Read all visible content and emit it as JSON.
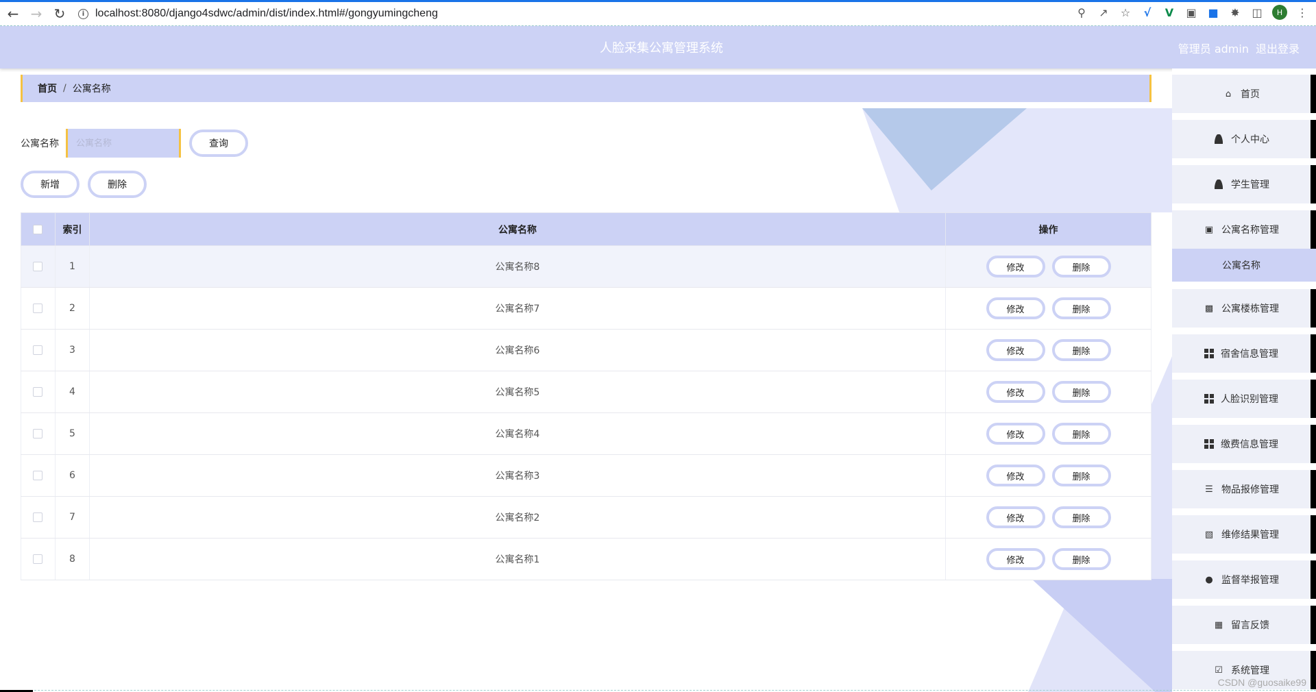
{
  "browser": {
    "url": "localhost:8080/django4sdwc/admin/dist/index.html#/gongyumingcheng",
    "profile_initial": "H"
  },
  "header": {
    "title": "人脸采集公寓管理系统",
    "user_label": "管理员 admin",
    "logout_label": "退出登录"
  },
  "breadcrumb": {
    "home": "首页",
    "separator": "/",
    "current": "公寓名称"
  },
  "search": {
    "label": "公寓名称",
    "placeholder": "公寓名称",
    "value": "",
    "query_label": "查询"
  },
  "actions": {
    "add_label": "新增",
    "delete_label": "删除"
  },
  "table": {
    "headers": {
      "index": "索引",
      "name": "公寓名称",
      "ops": "操作"
    },
    "edit_label": "修改",
    "delete_label": "删除",
    "rows": [
      {
        "index": "1",
        "name": "公寓名称8"
      },
      {
        "index": "2",
        "name": "公寓名称7"
      },
      {
        "index": "3",
        "name": "公寓名称6"
      },
      {
        "index": "4",
        "name": "公寓名称5"
      },
      {
        "index": "5",
        "name": "公寓名称4"
      },
      {
        "index": "6",
        "name": "公寓名称3"
      },
      {
        "index": "7",
        "name": "公寓名称2"
      },
      {
        "index": "8",
        "name": "公寓名称1"
      }
    ]
  },
  "sidebar": {
    "items": [
      {
        "label": "首页",
        "icon": "home-icon"
      },
      {
        "label": "个人中心",
        "icon": "person-icon"
      },
      {
        "label": "学生管理",
        "icon": "person-icon"
      },
      {
        "label": "公寓名称管理",
        "icon": "chat-icon"
      },
      {
        "label": "公寓名称",
        "icon": ""
      },
      {
        "label": "公寓楼栋管理",
        "icon": "briefcase-icon"
      },
      {
        "label": "宿舍信息管理",
        "icon": "grid-icon"
      },
      {
        "label": "人脸识别管理",
        "icon": "grid-icon"
      },
      {
        "label": "缴费信息管理",
        "icon": "grid-icon"
      },
      {
        "label": "物品报修管理",
        "icon": "sliders-icon"
      },
      {
        "label": "维修结果管理",
        "icon": "book-icon"
      },
      {
        "label": "监督举报管理",
        "icon": "pin-icon"
      },
      {
        "label": "留言反馈",
        "icon": "clipboard-icon"
      },
      {
        "label": "系统管理",
        "icon": "clipboard-check-icon"
      }
    ]
  },
  "watermark": "CSDN @guosaike99",
  "colors": {
    "accent": "#ccd2f5",
    "border_accent": "#f5c242",
    "sidebar_right": "#000000"
  }
}
